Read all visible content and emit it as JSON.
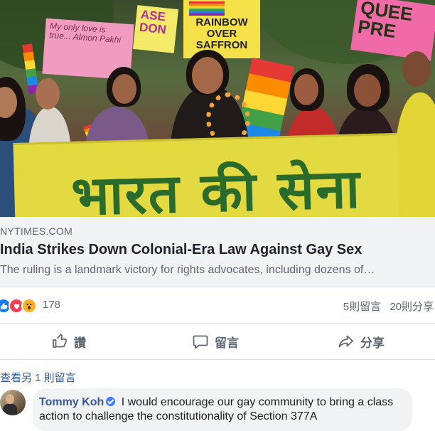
{
  "post": {
    "image": {
      "alt_signs": [
        "ASE DON",
        "RAINBOW OVER SAFFRON",
        "QUEE PRE",
        "My only love is true... Almon Pakhi"
      ],
      "banner_text": "भारत की सेना"
    },
    "link": {
      "domain": "NYTIMES.COM",
      "headline": "India Strikes Down Colonial-Era Law Against Gay Sex",
      "description": "The ruling is a landmark victory for rights advocates, including dozens of…"
    },
    "reactions": {
      "icons": [
        "like-icon",
        "love-icon",
        "wow-icon"
      ],
      "count": "178",
      "comments": "5則留言",
      "shares": "20則分享"
    },
    "actions": {
      "like_label": "讚",
      "comment_label": "留言",
      "share_label": "分享"
    },
    "comments": {
      "view_more": "查看另 1 則留言",
      "items": [
        {
          "author": "Tommy Koh",
          "verified": true,
          "text": "I would encourage our gay community to bring a class action to challenge the constitutionality of Section 377A"
        }
      ]
    }
  },
  "colors": {
    "link_blue": "#385898",
    "like_blue": "#1877f2",
    "love_red": "#f33e58",
    "wow_yellow": "#f7b125",
    "banner_yellow": "#e3d940",
    "banner_green": "#2a6b2c"
  }
}
